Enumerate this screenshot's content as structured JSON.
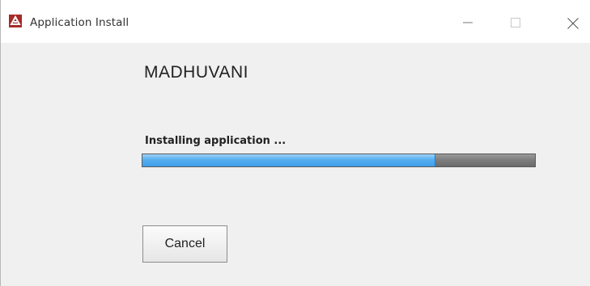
{
  "window": {
    "title": "Application Install",
    "controls": [
      "minimize-icon",
      "maximize-icon",
      "close-icon"
    ]
  },
  "main": {
    "heading": "MADHUVANI",
    "status_text": "Installing application ...",
    "progress_fraction": 0.746,
    "cancel_label": "Cancel"
  },
  "colors": {
    "progress_fill": "#4da8ee",
    "progress_track": "#7c7c7c",
    "app_icon_bg": "#a72a2a"
  }
}
